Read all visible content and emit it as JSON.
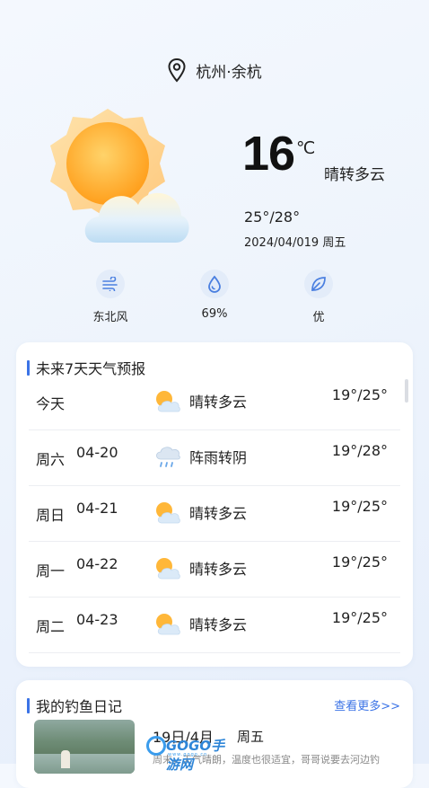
{
  "location": {
    "name": "杭州·余杭"
  },
  "current": {
    "temperature": "16",
    "unit": "℃",
    "condition": "晴转多云",
    "range": "25°/28°",
    "date_line": "2024/04/019 周五",
    "icon": "sun-cloud-icon"
  },
  "metrics": [
    {
      "icon": "wind-icon",
      "label": "东北风"
    },
    {
      "icon": "humidity-drop-icon",
      "label": "69%"
    },
    {
      "icon": "leaf-air-quality-icon",
      "label": "优"
    }
  ],
  "forecast": {
    "title": "未来7天天气预报",
    "rows": [
      {
        "day": "今天",
        "date": "",
        "icon": "partly-cloudy-icon",
        "condition": "晴转多云",
        "temps": "19°/25°"
      },
      {
        "day": "周六",
        "date": "04-20",
        "icon": "shower-cloud-icon",
        "condition": "阵雨转阴",
        "temps": "19°/28°"
      },
      {
        "day": "周日",
        "date": "04-21",
        "icon": "partly-cloudy-icon",
        "condition": "晴转多云",
        "temps": "19°/25°"
      },
      {
        "day": "周一",
        "date": "04-22",
        "icon": "partly-cloudy-icon",
        "condition": "晴转多云",
        "temps": "19°/25°"
      },
      {
        "day": "周二",
        "date": "04-23",
        "icon": "partly-cloudy-icon",
        "condition": "晴转多云",
        "temps": "19°/25°"
      }
    ]
  },
  "diary": {
    "title": "我的钓鱼日记",
    "more": "查看更多>>",
    "day": "19日/4月",
    "weekday": "周五",
    "text": "周末，天气晴朗，温度也很适宜，哥哥说要去河边钓"
  },
  "watermark": {
    "text": "GOGO手游网",
    "sub": "www.gogo.cn"
  },
  "colors": {
    "accent": "#3b73e6",
    "badge_bg": "#e3ecf9",
    "icon_blue": "#4a7fe0"
  }
}
